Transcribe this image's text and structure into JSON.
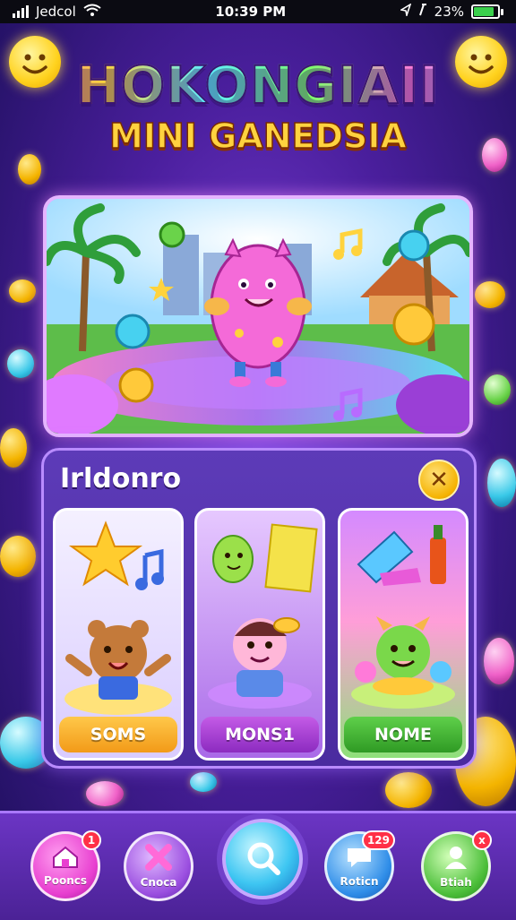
{
  "status_bar": {
    "carrier": "Jedcol",
    "time": "10:39 PM",
    "battery_text": "23%",
    "battery_level": 0.85
  },
  "header": {
    "title": "HOKONGIAII",
    "subtitle": "MINI GANEDSIA"
  },
  "panel": {
    "title": "Irldonro",
    "close_icon": "close-icon",
    "cards": [
      {
        "label": "SOMS",
        "color": "#f5a623"
      },
      {
        "label": "MONS1",
        "color": "#b13fd8"
      },
      {
        "label": "NOME",
        "color": "#3fb846"
      }
    ]
  },
  "bottom_nav": {
    "items": [
      {
        "label": "Pooncs",
        "badge": "1",
        "icon": "home-icon",
        "color": "#e83fd0"
      },
      {
        "label": "Cnoca",
        "badge": "",
        "icon": "cross-icon",
        "color": "#9b4fe0"
      },
      {
        "label": "",
        "badge": "",
        "icon": "search-icon",
        "color": "#3ec6f2"
      },
      {
        "label": "Roticn",
        "badge": "129",
        "icon": "chat-icon",
        "color": "#2f8de8"
      },
      {
        "label": "Btiah",
        "badge": "x",
        "icon": "profile-icon",
        "color": "#4cbf3a"
      }
    ]
  },
  "colors": {
    "background": "#4b1f9e",
    "accent_gold": "#ffd23f",
    "panel": "#5d3bb8"
  }
}
